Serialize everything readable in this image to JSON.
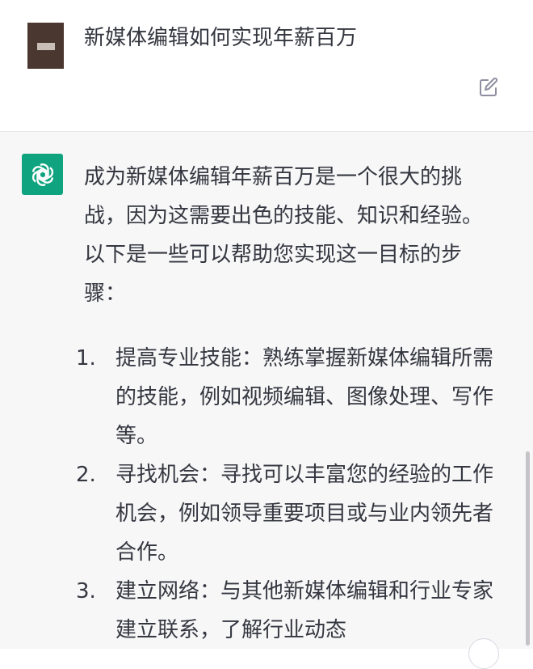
{
  "user_message": {
    "text": "新媒体编辑如何实现年薪百万"
  },
  "assistant_message": {
    "intro": "成为新媒体编辑年薪百万是一个很大的挑战，因为这需要出色的技能、知识和经验。以下是一些可以帮助您实现这一目标的步骤：",
    "steps": [
      {
        "num": "1.",
        "text": "提高专业技能：熟练掌握新媒体编辑所需的技能，例如视频编辑、图像处理、写作等。"
      },
      {
        "num": "2.",
        "text": "寻找机会：寻找可以丰富您的经验的工作机会，例如领导重要项目或与业内领先者合作。"
      },
      {
        "num": "3.",
        "text": "建立网络：与其他新媒体编辑和行业专家建立联系，了解行业动态"
      }
    ]
  },
  "icons": {
    "user_avatar": "user-avatar-image",
    "edit": "edit-icon",
    "assistant_avatar": "openai-logo-icon"
  },
  "colors": {
    "assistant_avatar_bg": "#10a37f",
    "assistant_bg": "#f7f7f8",
    "text": "#353740"
  }
}
